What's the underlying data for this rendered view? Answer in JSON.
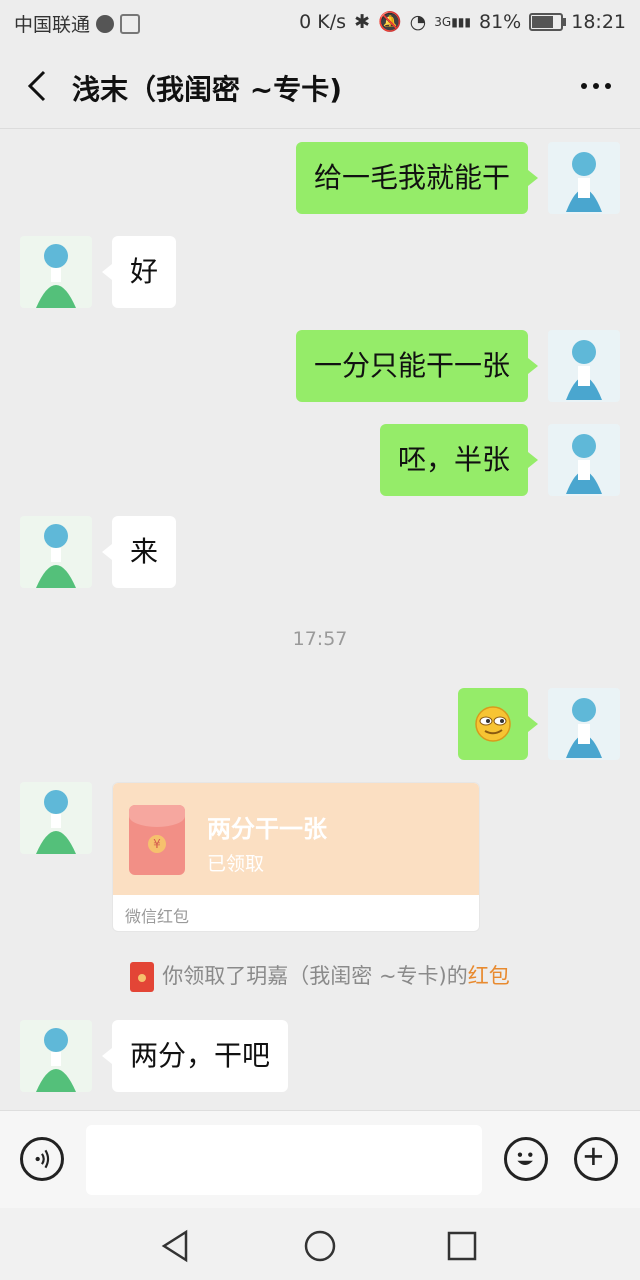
{
  "status_bar": {
    "carrier": "中国联通",
    "net_speed": "0 K/s",
    "signal_type": "3G",
    "battery": "81%",
    "battery_level": 0.81,
    "time": "18:21"
  },
  "header": {
    "title": "浅末（我闺密 ~专卡)"
  },
  "messages": [
    {
      "side": "right",
      "text": "给一毛我就能干"
    },
    {
      "side": "left",
      "text": "好"
    },
    {
      "side": "right",
      "text": "一分只能干一张"
    },
    {
      "side": "right",
      "text": "呸，半张"
    },
    {
      "side": "left",
      "text": "来"
    },
    {
      "side": "center",
      "text": "17:57"
    },
    {
      "side": "right",
      "emoji": "smirk-emoji"
    },
    {
      "side": "left",
      "red_packet": {
        "title": "两分干一张",
        "status": "已领取",
        "footer": "微信红包"
      }
    },
    {
      "side": "center",
      "system": {
        "prefix": "你领取了玥嘉（我闺密 ~专卡)的",
        "link": "红包"
      }
    },
    {
      "side": "left",
      "text": "两分，干吧"
    }
  ],
  "colors": {
    "sent_bubble": "#95ec69",
    "received_bubble": "#ffffff",
    "background": "#ededed",
    "red_packet_bg": "#fbdfc2",
    "link": "#e88a2f"
  },
  "icons": {
    "back": "back-arrow-icon",
    "more": "more-dots-icon",
    "voice": "voice-icon",
    "emoji": "emoji-icon",
    "plus": "plus-icon",
    "nav_back": "nav-back-icon",
    "nav_home": "nav-home-icon",
    "nav_recent": "nav-recent-icon"
  }
}
